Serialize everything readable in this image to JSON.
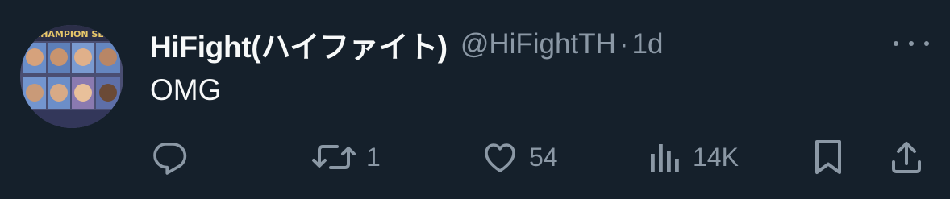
{
  "tweet": {
    "display_name": "HiFight(ハイファイト)",
    "handle": "@HiFightTH",
    "separator": "·",
    "time": "1d",
    "text": "OMG",
    "avatar_banner": "CHAMPION SEL"
  },
  "actions": {
    "reply_count": "",
    "retweet_count": "1",
    "like_count": "54",
    "views_count": "14K"
  },
  "colors": {
    "background": "#15202b",
    "primary_text": "#f7f9f9",
    "secondary_text": "#8b98a5"
  },
  "icons": [
    "reply-icon",
    "retweet-icon",
    "like-icon",
    "views-icon",
    "bookmark-icon",
    "share-icon",
    "more-icon"
  ]
}
